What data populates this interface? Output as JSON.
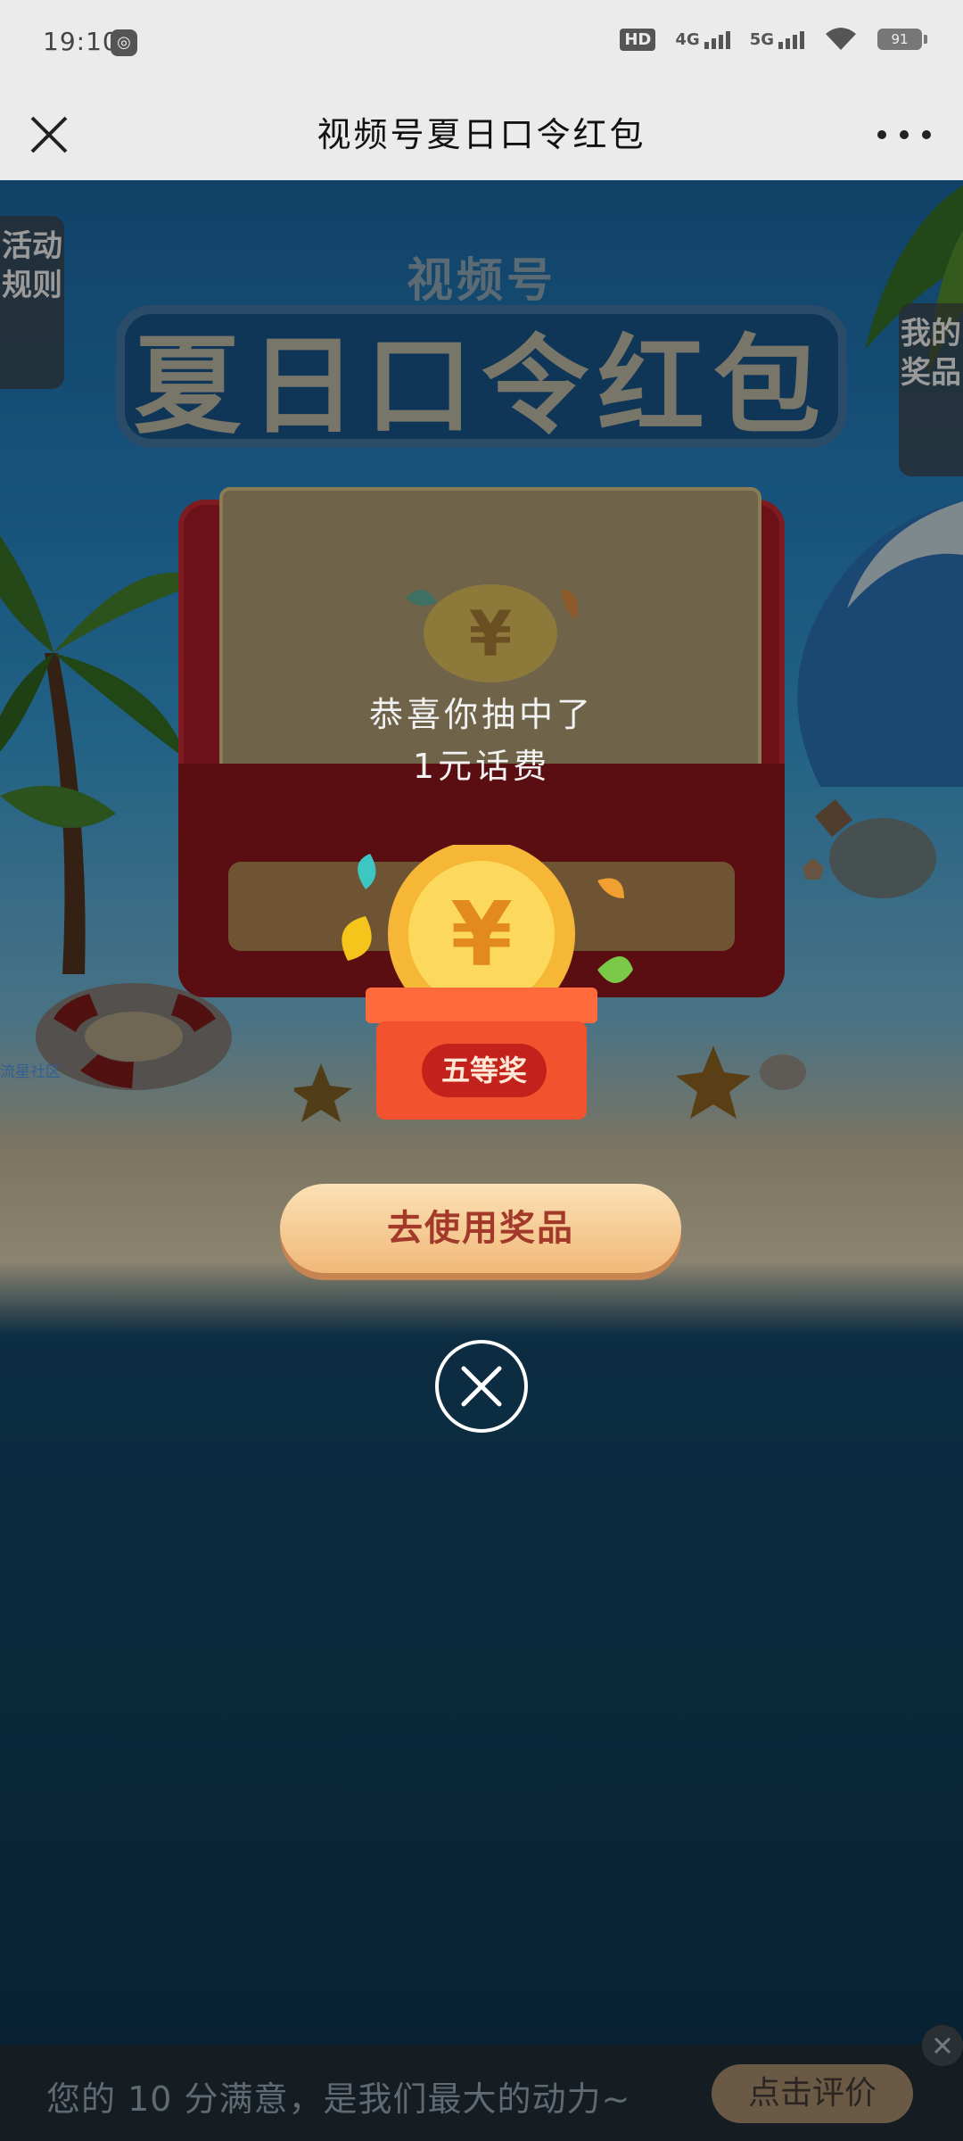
{
  "status_bar": {
    "time": "19:10",
    "network_badge": "HD",
    "network_1": "4G",
    "network_2": "5G",
    "battery": "91",
    "icons": [
      "location-icon",
      "hd-icon",
      "signal-4g-icon",
      "signal-5g-icon",
      "wifi-icon",
      "battery-icon"
    ]
  },
  "nav": {
    "title": "视频号夏日口令红包",
    "close_icon": "close-icon",
    "more_icon": "more-icon"
  },
  "banner": {
    "subtitle": "视频号",
    "title": "夏日口令红包"
  },
  "side_tabs": {
    "rules": "活动规则",
    "my_prizes": "我的奖品"
  },
  "watermark": "流星社区",
  "result": {
    "line1": "恭喜你抽中了",
    "line2": "1元话费",
    "prize_tier": "五等奖"
  },
  "actions": {
    "use_prize": "去使用奖品",
    "dismiss_icon": "close-circle-icon"
  },
  "feedback": {
    "text": "您的 10 分满意，是我们最大的动力~",
    "button": "点击评价"
  },
  "colors": {
    "accent_button": "#f1b878",
    "prize_red": "#c3221c",
    "background": "#0f3c58"
  }
}
